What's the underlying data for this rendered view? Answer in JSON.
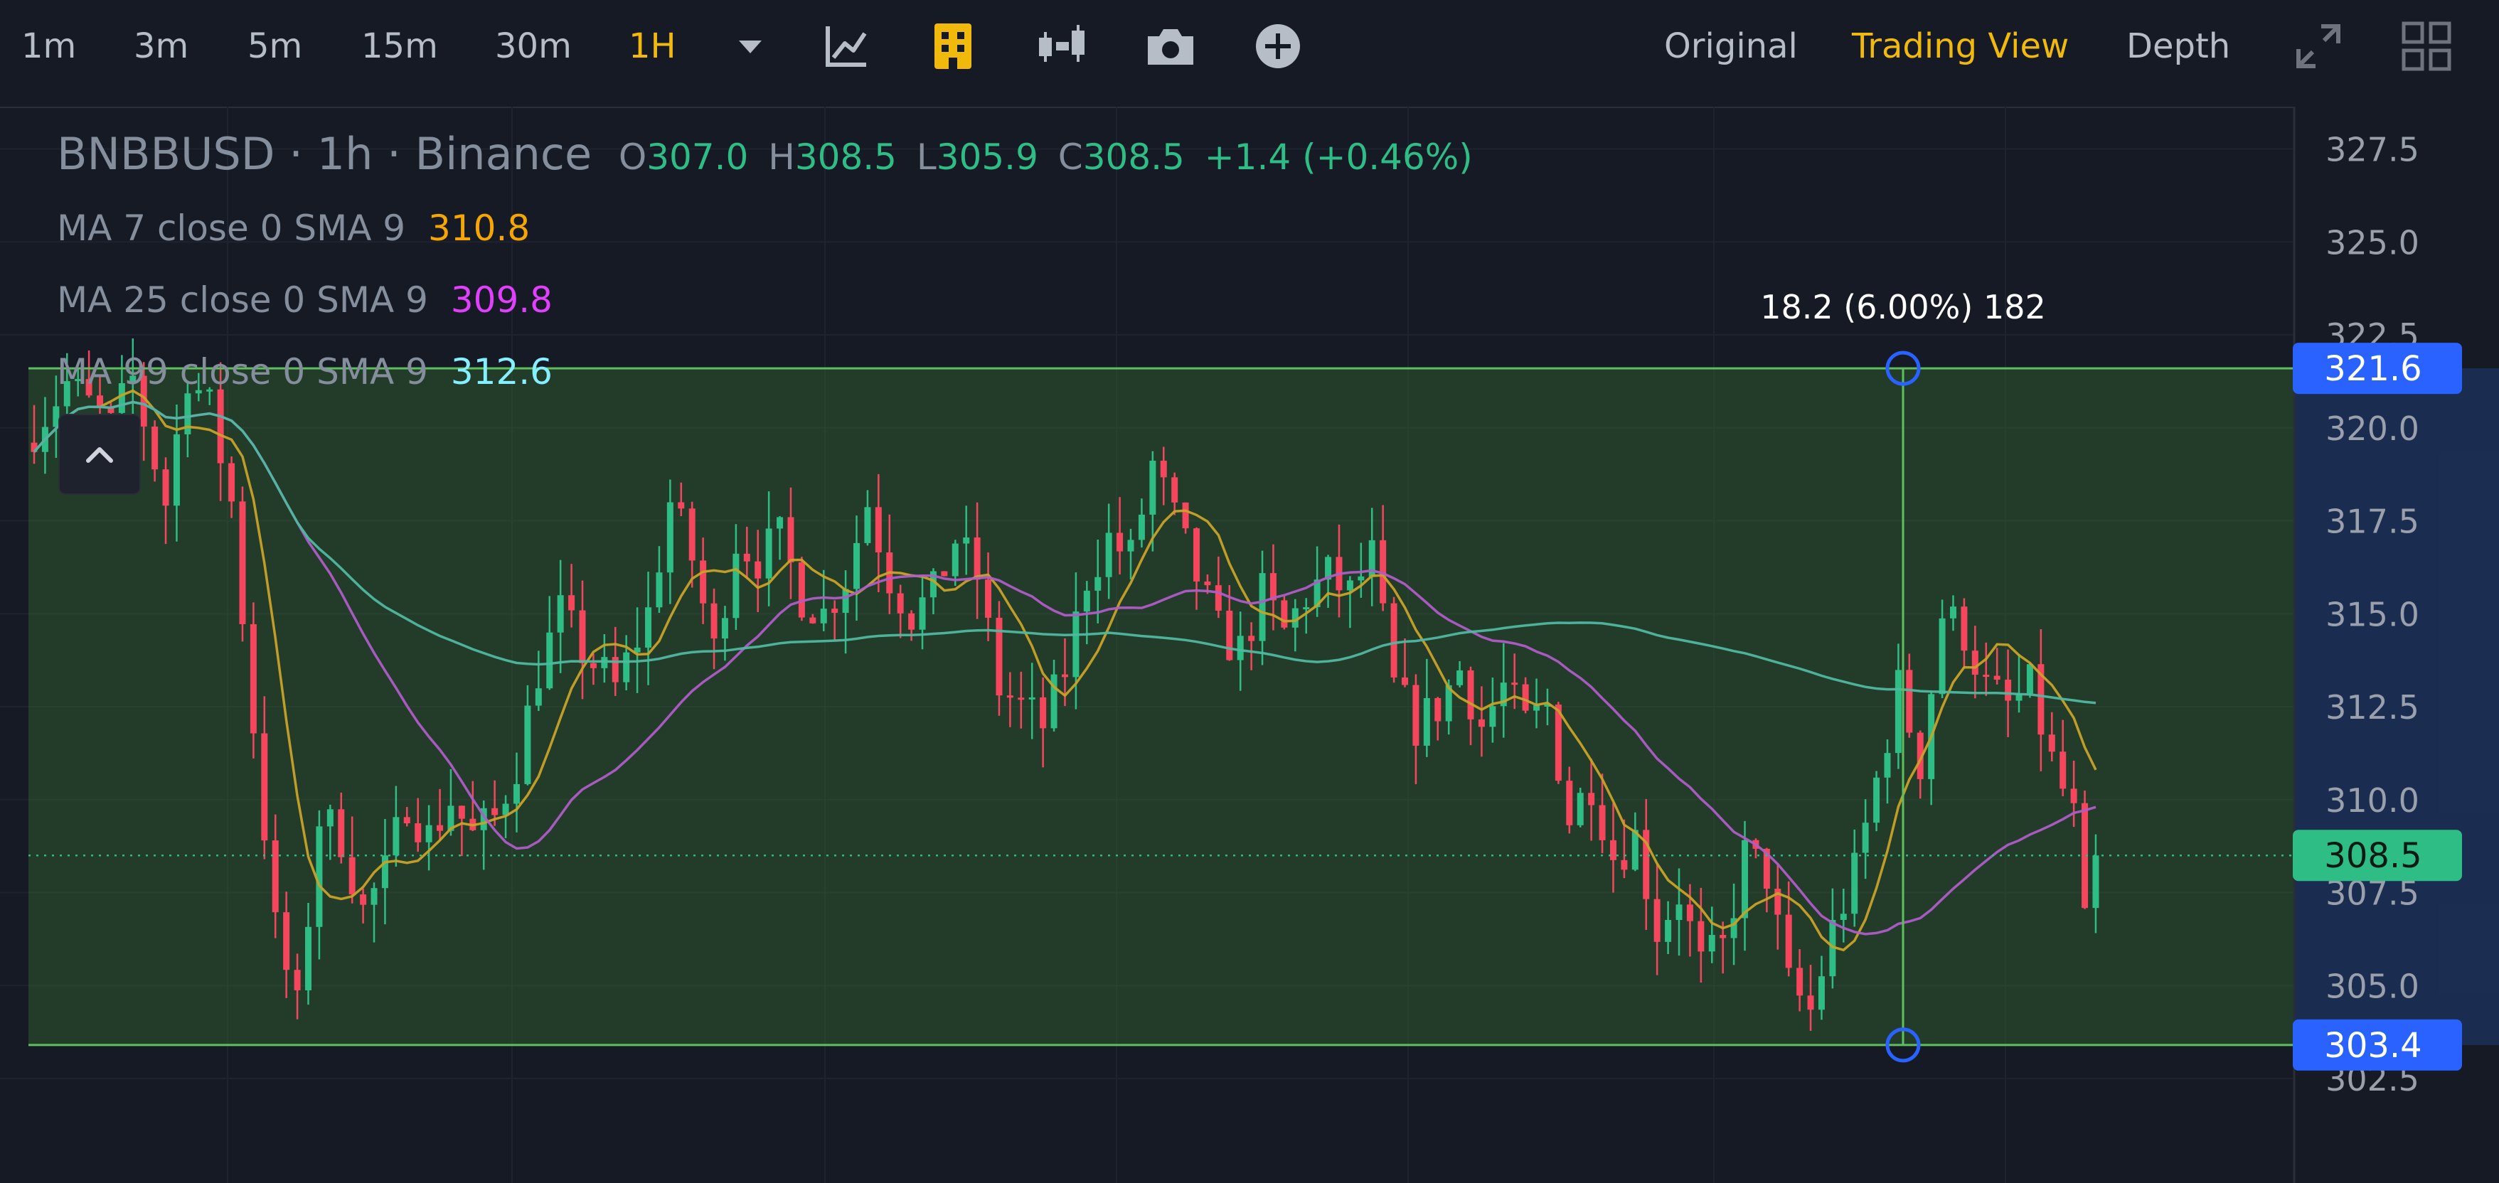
{
  "toolbar": {
    "intervals": [
      "1m",
      "3m",
      "5m",
      "15m",
      "30m",
      "1H"
    ],
    "active_interval": "1H",
    "views": [
      "Original",
      "Trading View",
      "Depth"
    ],
    "active_view": "Trading View",
    "icons": [
      "dropdown-caret-icon",
      "indicators-icon",
      "candle-type-icon",
      "chart-style-icon",
      "camera-icon",
      "add-icon",
      "fullscreen-icon",
      "layout-grid-icon"
    ]
  },
  "legend": {
    "symbol": "BNBBUSD",
    "sep1": "·",
    "interval": "1h",
    "sep2": "·",
    "exchange": "Binance",
    "ohlc": {
      "o_label": "O",
      "o": "307.0",
      "h_label": "H",
      "h": "308.5",
      "l_label": "L",
      "l": "305.9",
      "c_label": "C",
      "c": "308.5",
      "change": "+1.4 (+0.46%)"
    },
    "ma": [
      {
        "label": "MA 7 close 0 SMA 9",
        "value": "310.8",
        "color": "#f7a600"
      },
      {
        "label": "MA 25 close 0 SMA 9",
        "value": "309.8",
        "color": "#e040fb"
      },
      {
        "label": "MA 99 close 0 SMA 9",
        "value": "312.6",
        "color": "#84f0ff"
      }
    ]
  },
  "price_labels": {
    "top": "321.6",
    "last": "308.5",
    "bottom": "303.4"
  },
  "measure": {
    "label": "18.2 (6.00%) 182"
  },
  "colors": {
    "bg": "#161a25",
    "up": "#2ebd85",
    "down": "#f6465d",
    "accent": "#f0b90b",
    "range_box": "#2f5a2f",
    "range_line": "#5fbf5f",
    "marker": "#2962ff"
  },
  "chart_data": {
    "type": "candlestick",
    "symbol": "BNBBUSD",
    "interval": "1h",
    "ylim": [
      301.5,
      329
    ],
    "yticks": [
      302.5,
      305.0,
      307.5,
      310.0,
      312.5,
      315.0,
      317.5,
      320.0,
      322.5,
      325.0,
      327.5
    ],
    "grid": true,
    "anchors": [
      {
        "i": 0,
        "p": 320.0
      },
      {
        "i": 3,
        "p": 321.2
      },
      {
        "i": 7,
        "p": 320.0
      },
      {
        "i": 9,
        "p": 321.3
      },
      {
        "i": 12,
        "p": 318.0
      },
      {
        "i": 14,
        "p": 321.5
      },
      {
        "i": 16,
        "p": 320.5
      },
      {
        "i": 18,
        "p": 318.0
      },
      {
        "i": 20,
        "p": 312.0
      },
      {
        "i": 22,
        "p": 306.5
      },
      {
        "i": 24,
        "p": 304.3
      },
      {
        "i": 26,
        "p": 309.5
      },
      {
        "i": 28,
        "p": 309.0
      },
      {
        "i": 30,
        "p": 307.0
      },
      {
        "i": 32,
        "p": 308.0
      },
      {
        "i": 34,
        "p": 310.0
      },
      {
        "i": 36,
        "p": 309.0
      },
      {
        "i": 38,
        "p": 310.0
      },
      {
        "i": 40,
        "p": 309.0
      },
      {
        "i": 42,
        "p": 309.5
      },
      {
        "i": 44,
        "p": 311.0
      },
      {
        "i": 46,
        "p": 313.5
      },
      {
        "i": 48,
        "p": 315.0
      },
      {
        "i": 50,
        "p": 314.0
      },
      {
        "i": 53,
        "p": 313.0
      },
      {
        "i": 56,
        "p": 315.0
      },
      {
        "i": 58,
        "p": 318.0
      },
      {
        "i": 60,
        "p": 316.5
      },
      {
        "i": 62,
        "p": 314.0
      },
      {
        "i": 64,
        "p": 317.0
      },
      {
        "i": 66,
        "p": 316.5
      },
      {
        "i": 68,
        "p": 317.0
      },
      {
        "i": 70,
        "p": 315.5
      },
      {
        "i": 72,
        "p": 315.0
      },
      {
        "i": 74,
        "p": 316.0
      },
      {
        "i": 76,
        "p": 318.0
      },
      {
        "i": 78,
        "p": 316.0
      },
      {
        "i": 80,
        "p": 315.0
      },
      {
        "i": 82,
        "p": 315.5
      },
      {
        "i": 84,
        "p": 317.0
      },
      {
        "i": 86,
        "p": 316.0
      },
      {
        "i": 88,
        "p": 313.0
      },
      {
        "i": 90,
        "p": 312.5
      },
      {
        "i": 92,
        "p": 312.0
      },
      {
        "i": 94,
        "p": 313.5
      },
      {
        "i": 96,
        "p": 316.0
      },
      {
        "i": 98,
        "p": 317.0
      },
      {
        "i": 100,
        "p": 316.5
      },
      {
        "i": 102,
        "p": 319.0
      },
      {
        "i": 104,
        "p": 317.5
      },
      {
        "i": 106,
        "p": 316.0
      },
      {
        "i": 108,
        "p": 314.5
      },
      {
        "i": 110,
        "p": 314.0
      },
      {
        "i": 112,
        "p": 315.5
      },
      {
        "i": 114,
        "p": 314.5
      },
      {
        "i": 116,
        "p": 315.5
      },
      {
        "i": 118,
        "p": 316.0
      },
      {
        "i": 120,
        "p": 315.5
      },
      {
        "i": 122,
        "p": 316.5
      },
      {
        "i": 124,
        "p": 313.0
      },
      {
        "i": 126,
        "p": 312.0
      },
      {
        "i": 128,
        "p": 312.5
      },
      {
        "i": 130,
        "p": 313.5
      },
      {
        "i": 132,
        "p": 312.0
      },
      {
        "i": 134,
        "p": 313.0
      },
      {
        "i": 136,
        "p": 312.0
      },
      {
        "i": 138,
        "p": 312.5
      },
      {
        "i": 140,
        "p": 309.5
      },
      {
        "i": 142,
        "p": 310.5
      },
      {
        "i": 144,
        "p": 308.5
      },
      {
        "i": 146,
        "p": 309.0
      },
      {
        "i": 148,
        "p": 306.5
      },
      {
        "i": 150,
        "p": 307.5
      },
      {
        "i": 152,
        "p": 305.5
      },
      {
        "i": 154,
        "p": 306.0
      },
      {
        "i": 156,
        "p": 308.5
      },
      {
        "i": 158,
        "p": 308.0
      },
      {
        "i": 160,
        "p": 305.0
      },
      {
        "i": 162,
        "p": 304.3
      },
      {
        "i": 164,
        "p": 306.5
      },
      {
        "i": 166,
        "p": 308.0
      },
      {
        "i": 168,
        "p": 310.5
      },
      {
        "i": 170,
        "p": 313.0
      },
      {
        "i": 172,
        "p": 311.0
      },
      {
        "i": 174,
        "p": 315.0
      },
      {
        "i": 176,
        "p": 314.5
      },
      {
        "i": 178,
        "p": 313.0
      },
      {
        "i": 180,
        "p": 312.5
      },
      {
        "i": 182,
        "p": 313.0
      },
      {
        "i": 184,
        "p": 311.0
      },
      {
        "i": 186,
        "p": 309.5
      },
      {
        "i": 187,
        "p": 306.5
      },
      {
        "i": 188,
        "p": 308.5
      }
    ],
    "ma": [
      {
        "name": "MA 7",
        "color": "#c9a227",
        "last": 310.8
      },
      {
        "name": "MA 25",
        "color": "#b05cc8",
        "last": 309.8
      },
      {
        "name": "MA 99",
        "color": "#4fb8a0",
        "last": 312.6
      }
    ],
    "price_range_tool": {
      "top": 321.6,
      "bottom": 303.4,
      "diff": 18.2,
      "percent": 6.0,
      "ticks": 182
    },
    "last_price": 308.5
  }
}
